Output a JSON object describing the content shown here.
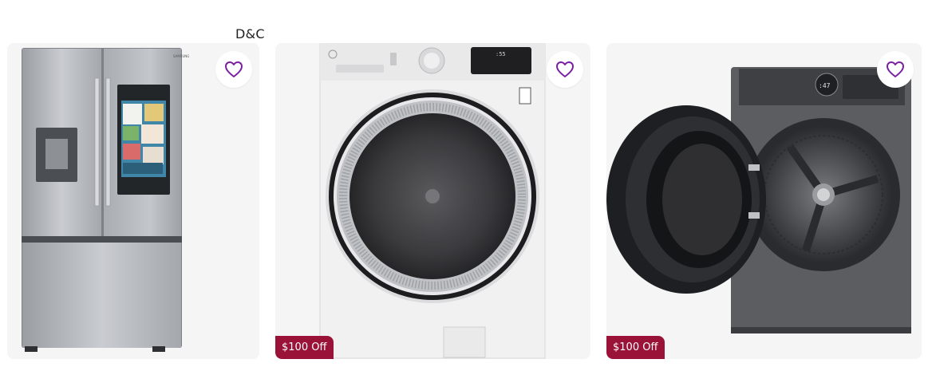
{
  "brand_label": "D&C",
  "colors": {
    "card_bg": "#f5f5f5",
    "heart": "#7b1fa2",
    "badge_bg": "#9b1239",
    "badge_text": "#ffffff"
  },
  "products": [
    {
      "image": "stainless-french-door-refrigerator-with-touchscreen",
      "favorite_icon": "heart-outline-icon",
      "badge": ""
    },
    {
      "image": "white-front-load-washer",
      "favorite_icon": "heart-outline-icon",
      "badge": "$100 Off"
    },
    {
      "image": "titanium-front-load-washer-door-open",
      "favorite_icon": "heart-outline-icon",
      "badge": "$100 Off"
    }
  ]
}
